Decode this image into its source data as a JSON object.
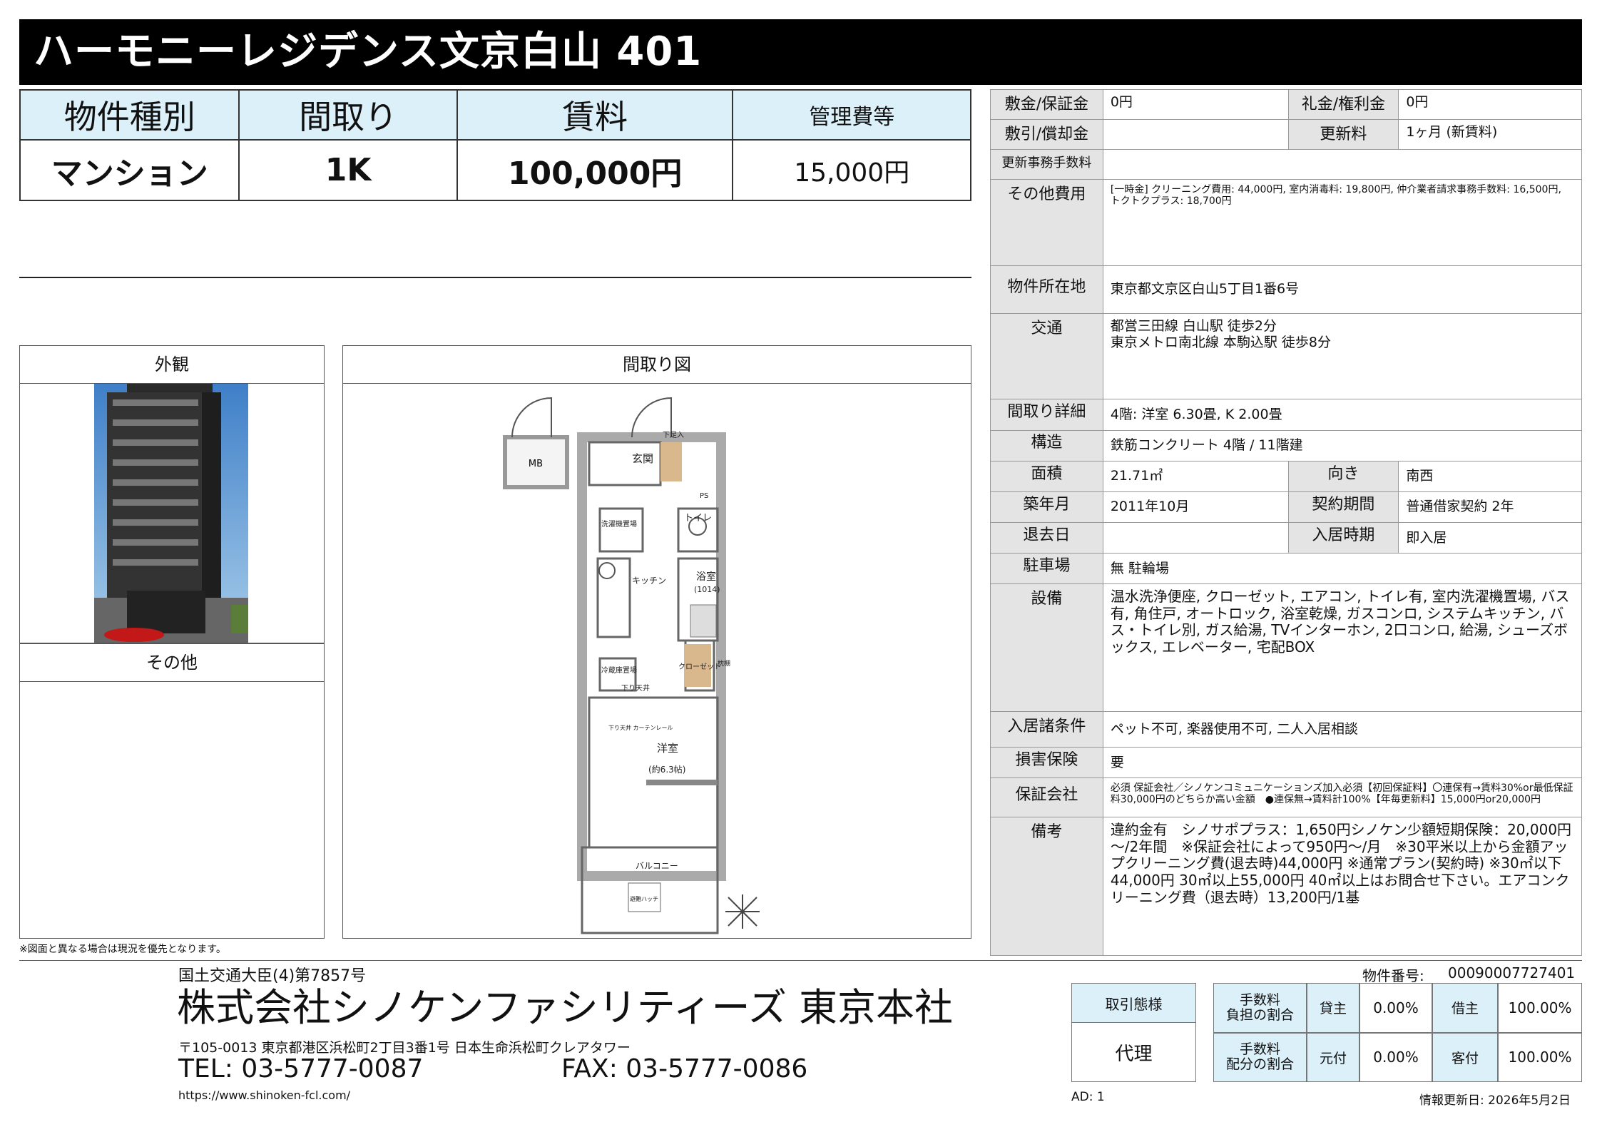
{
  "title": "ハーモニーレジデンス文京白山 401",
  "summary": {
    "headers": [
      "物件種別",
      "間取り",
      "賃料",
      "管理費等"
    ],
    "values": [
      "マンション",
      "1K",
      "100,000円",
      "15,000円"
    ]
  },
  "panels": {
    "exterior": "外観",
    "floorplan": "間取り図",
    "other": "その他"
  },
  "floorplan_labels": {
    "mb": "MB",
    "genkan": "玄関",
    "shoes": "下足入",
    "ps": "PS",
    "laundry": "洗濯機置場",
    "toilet": "トイレ",
    "kitchen": "キッチン",
    "bath": "浴室",
    "bath_size": "(1014)",
    "fridge": "冷蔵庫置場",
    "closet": "クローゼット",
    "shelf": "枕棚",
    "ceiling": "下り天井",
    "room": "洋室",
    "room_size": "(約6.3帖)",
    "curtain": "下り天井 カーテンレール",
    "balcony": "バルコニー",
    "hatch": "避難ハッチ"
  },
  "note_diagram": "※図面と異なる場合は現況を優先となります。",
  "details": {
    "shikikin_label": "敷金/保証金",
    "shikikin": "0円",
    "reikin_label": "礼金/権利金",
    "reikin": "0円",
    "shikibiki_label": "敷引/償却金",
    "shikibiki": "",
    "koshin_label": "更新料",
    "koshin": "1ヶ月 (新賃料)",
    "koshin_jimu_label": "更新事務手数料",
    "koshin_jimu": "",
    "sonota_label": "その他費用",
    "sonota": "[一時金] クリーニング費用: 44,000円, 室内消毒料: 19,800円, 仲介業者請求事務手数料: 16,500円, トクトクプラス: 18,700円",
    "address_label": "物件所在地",
    "address": "東京都文京区白山5丁目1番6号",
    "kotsu_label": "交通",
    "kotsu1": "都営三田線 白山駅 徒歩2分",
    "kotsu2": "東京メトロ南北線 本駒込駅 徒歩8分",
    "madori_label": "間取り詳細",
    "madori": "4階: 洋室 6.30畳, K 2.00畳",
    "kozo_label": "構造",
    "kozo": "鉄筋コンクリート 4階 / 11階建",
    "menseki_label": "面積",
    "menseki": "21.71㎡",
    "muki_label": "向き",
    "muki": "南西",
    "chiku_label": "築年月",
    "chiku": "2011年10月",
    "keiyaku_label": "契約期間",
    "keiyaku": "普通借家契約 2年",
    "taikyo_label": "退去日",
    "taikyo": "",
    "nyukyo_label": "入居時期",
    "nyukyo": "即入居",
    "parking_label": "駐車場",
    "parking": "無 駐輪場",
    "setsubi_label": "設備",
    "setsubi": "温水洗浄便座, クローゼット, エアコン, トイレ有, 室内洗濯機置場, バス有, 角住戸, オートロック, 浴室乾燥, ガスコンロ, システムキッチン, バス・トイレ別, ガス給湯, TVインターホン, 2口コンロ, 給湯, シューズボックス, エレベーター, 宅配BOX",
    "joken_label": "入居諸条件",
    "joken": "ペット不可, 楽器使用不可, 二人入居相談",
    "hoken_label": "損害保険",
    "hoken": "要",
    "hosho_label": "保証会社",
    "hosho": "必須 保証会社／シノケンコミュニケーションズ加入必須【初回保証料】〇連保有→賃料30%or最低保証料30,000円のどちらか高い金額　●連保無→賃料計100%【年毎更新料】15,000円or20,000円",
    "biko_label": "備考",
    "biko": "違約金有　シノサポプラス：1,650円シノケン少額短期保険：20,000円～/2年間　※保証会社によって950円～/月　※30平米以上から金額アップクリーニング費(退去時)44,000円 ※通常プラン(契約時) ※30㎡以下44,000円 30㎡以上55,000円 40㎡以上はお問合せ下さい。エアコンクリーニング費（退去時）13,200円/1基"
  },
  "company": {
    "license": "国土交通大臣(4)第7857号",
    "name": "株式会社シノケンファシリティーズ 東京本社",
    "address": "〒105-0013 東京都港区浜松町2丁目3番1号 日本生命浜松町クレアタワー",
    "tel": "TEL: 03-5777-0087",
    "fax": "FAX: 03-5777-0086",
    "url": "https://www.shinoken-fcl.com/"
  },
  "property_no_label": "物件番号:",
  "property_no": "00090007727401",
  "torihiki": {
    "label": "取引態様",
    "value": "代理"
  },
  "fee": {
    "row1_label": "手数料\n負担の割合",
    "row2_label": "手数料\n配分の割合",
    "kashinushi": "貸主",
    "kashinushi_val": "0.00%",
    "karinushi": "借主",
    "karinushi_val": "100.00%",
    "motozuke": "元付",
    "motozuke_val": "0.00%",
    "kyakuzuke": "客付",
    "kyakuzuke_val": "100.00%"
  },
  "ad": "AD: 1",
  "updated": "情報更新日: 2026年5月2日",
  "colors": {
    "header_bg": "#dcf0fa",
    "label_bg": "#e4e4e4",
    "title_bg": "#000000"
  }
}
